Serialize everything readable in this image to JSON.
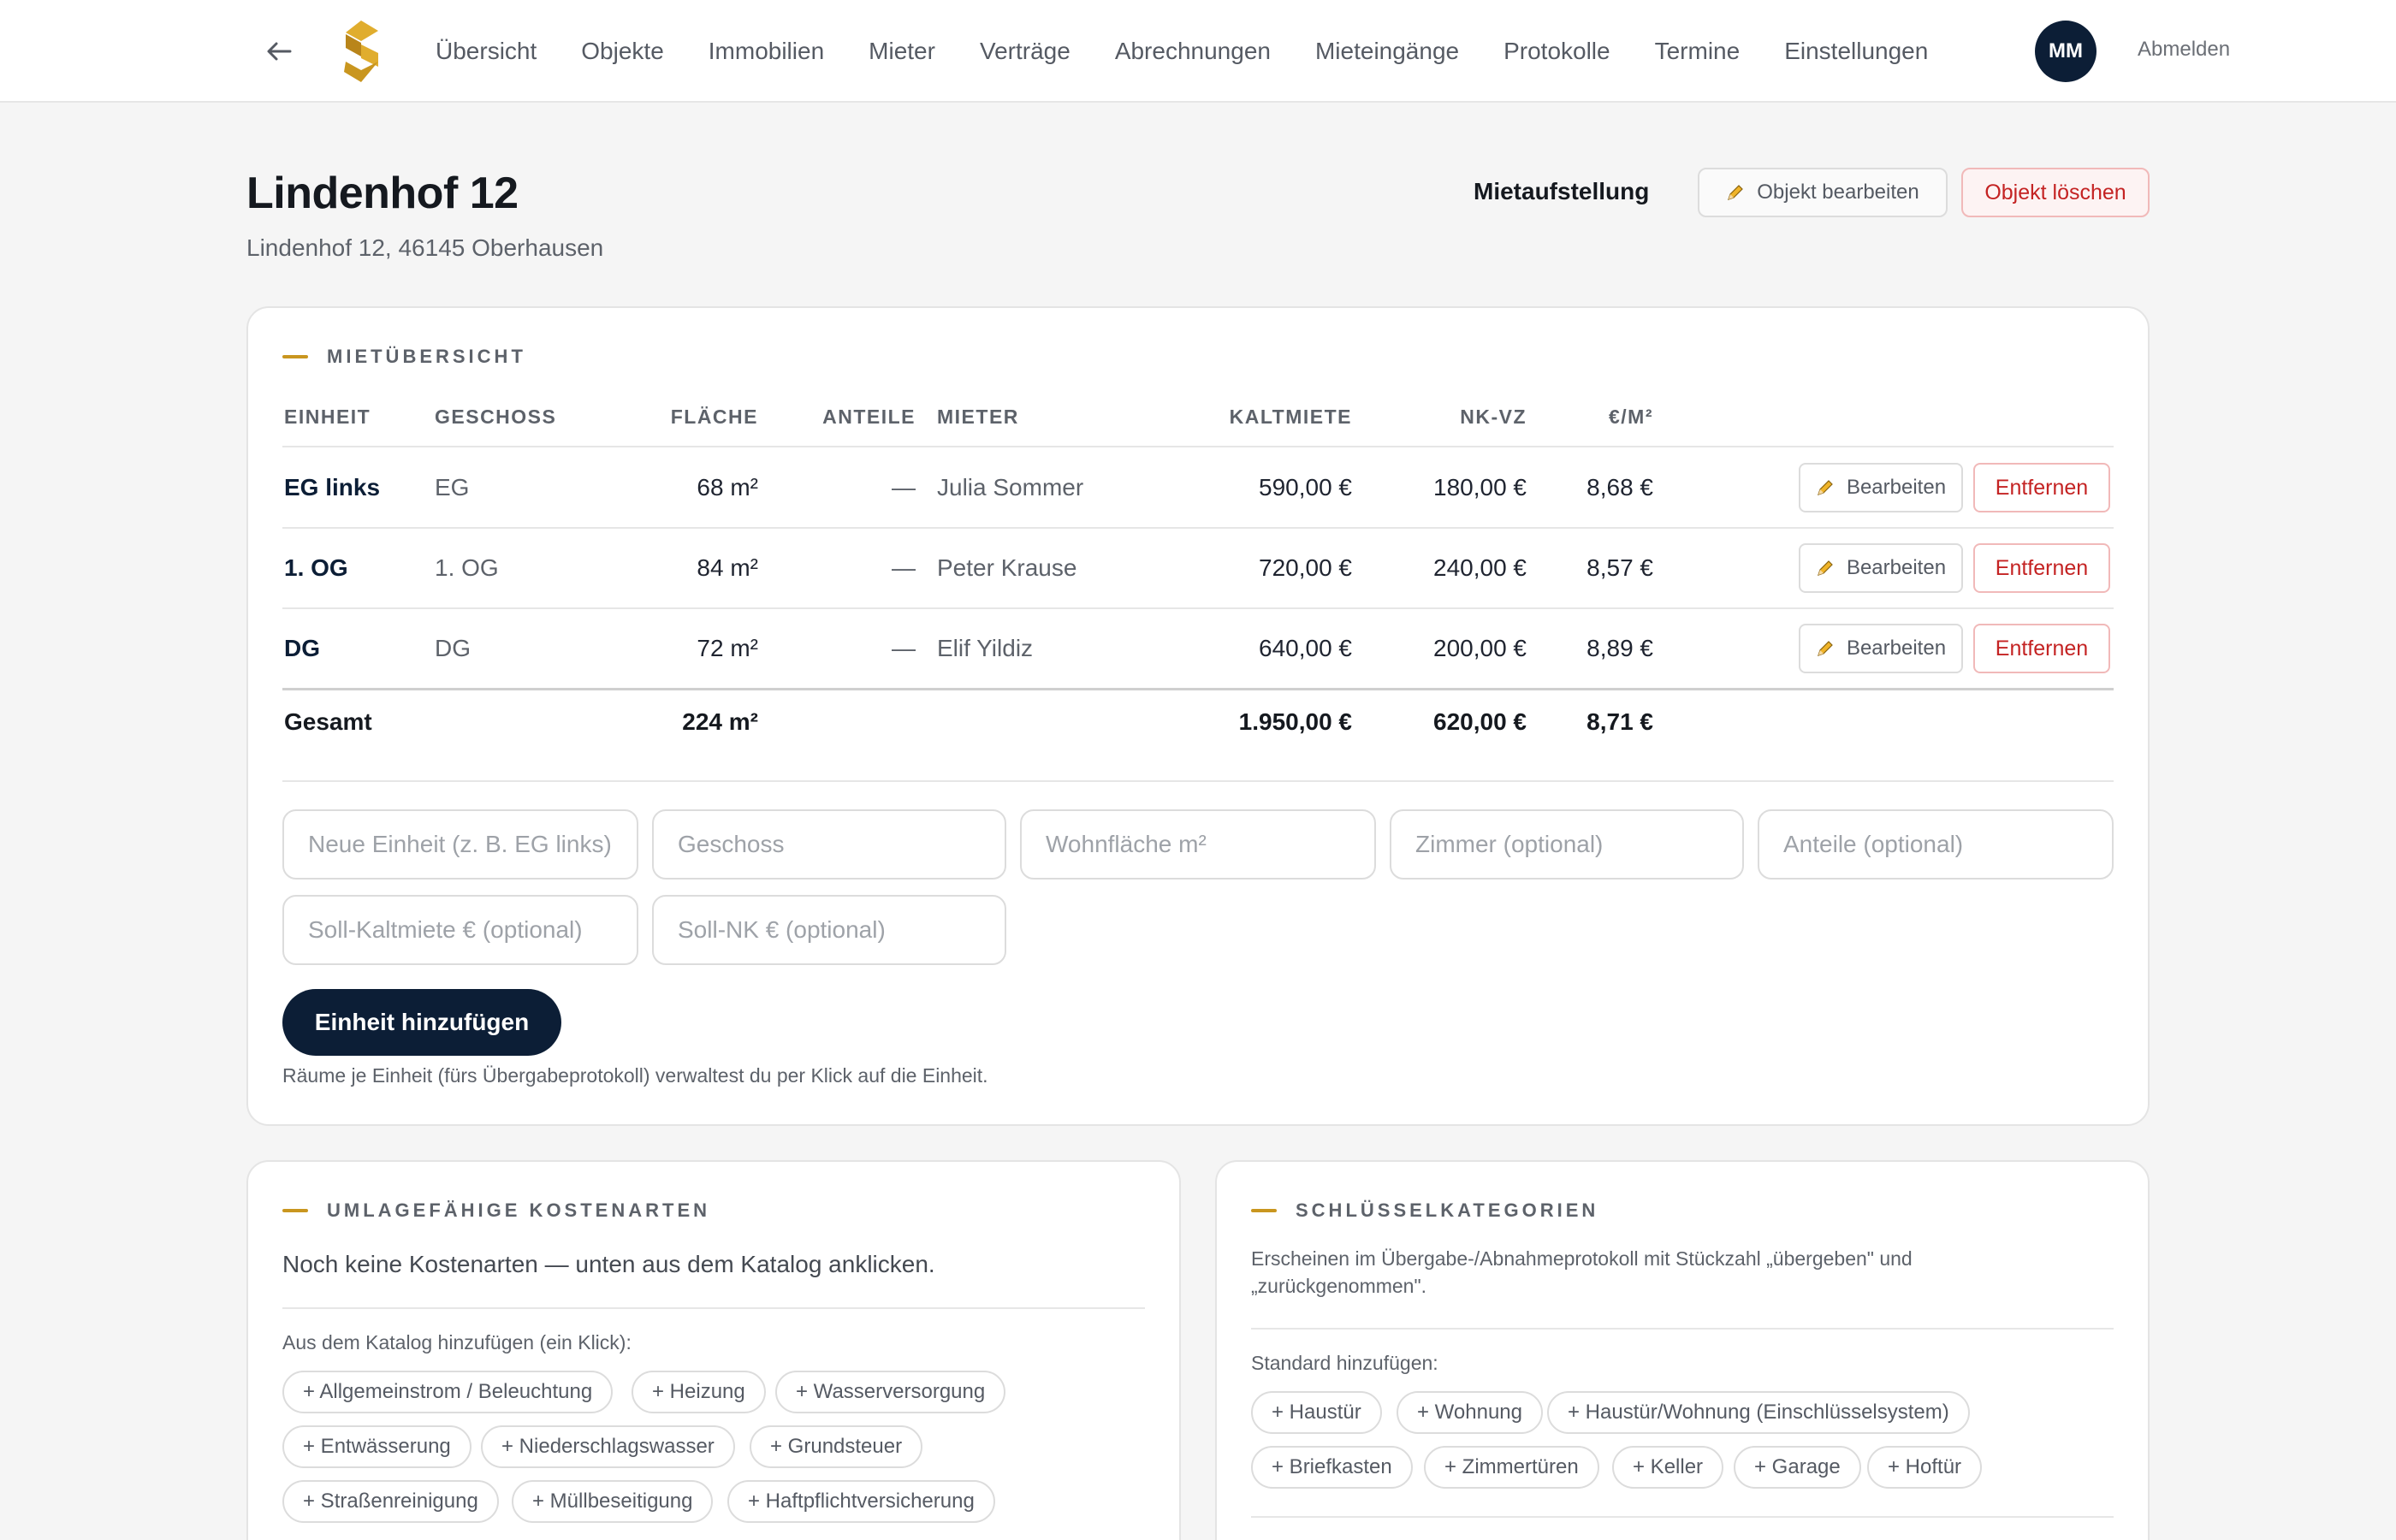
{
  "nav": {
    "links": [
      "Übersicht",
      "Objekte",
      "Immobilien",
      "Mieter",
      "Verträge",
      "Abrechnungen",
      "Mieteingänge",
      "Protokolle",
      "Termine",
      "Einstellungen"
    ],
    "avatar_initials": "MM",
    "logout_label": "Abmelden",
    "icons": {
      "back": "arrow-left-icon",
      "logo": "brand-logo"
    },
    "brand_color": "#c9961f"
  },
  "header": {
    "title": "Lindenhof 12",
    "address": "Lindenhof 12, 46145 Oberhausen",
    "rent_list_label": "Mietaufstellung",
    "edit_label": "Objekt bearbeiten",
    "delete_label": "Objekt löschen"
  },
  "rent_overview": {
    "section_title": "MIETÜBERSICHT",
    "columns": [
      "EINHEIT",
      "GESCHOSS",
      "FLÄCHE",
      "ANTEILE",
      "MIETER",
      "KALTMIETE",
      "NK-VZ",
      "€/M²"
    ],
    "rows": [
      {
        "unit": "EG links",
        "floor": "EG",
        "area": "68 m²",
        "shares": "—",
        "tenant": "Julia Sommer",
        "cold_rent": "590,00 €",
        "nk": "180,00 €",
        "per_sqm": "8,68 €"
      },
      {
        "unit": "1. OG",
        "floor": "1. OG",
        "area": "84 m²",
        "shares": "—",
        "tenant": "Peter Krause",
        "cold_rent": "720,00 €",
        "nk": "240,00 €",
        "per_sqm": "8,57 €"
      },
      {
        "unit": "DG",
        "floor": "DG",
        "area": "72 m²",
        "shares": "—",
        "tenant": "Elif Yildiz",
        "cold_rent": "640,00 €",
        "nk": "200,00 €",
        "per_sqm": "8,89 €"
      }
    ],
    "row_edit_label": "Bearbeiten",
    "row_remove_label": "Entfernen",
    "total": {
      "label": "Gesamt",
      "area": "224 m²",
      "cold_rent": "1.950,00 €",
      "nk": "620,00 €",
      "per_sqm": "8,71 €"
    },
    "form": {
      "unit_placeholder": "Neue Einheit (z. B. EG links)",
      "floor_placeholder": "Geschoss",
      "area_placeholder": "Wohnfläche m²",
      "rooms_placeholder": "Zimmer (optional)",
      "shares_placeholder": "Anteile (optional)",
      "cold_rent_placeholder": "Soll-Kaltmiete € (optional)",
      "nk_placeholder": "Soll-NK € (optional)",
      "submit_label": "Einheit hinzufügen"
    },
    "hint": "Räume je Einheit (fürs Übergabeprotokoll) verwaltest du per Klick auf die Einheit."
  },
  "cost_types": {
    "section_title": "UMLAGEFÄHIGE KOSTENARTEN",
    "empty_text": "Noch keine Kostenarten — unten aus dem Katalog anklicken.",
    "catalog_label": "Aus dem Katalog hinzufügen (ein Klick):",
    "catalog": [
      "+ Allgemeinstrom / Beleuchtung",
      "+ Heizung",
      "+ Wasserversorgung",
      "+ Entwässerung",
      "+ Niederschlagswasser",
      "+ Grundsteuer",
      "+ Straßenreinigung",
      "+ Müllbeseitigung",
      "+ Haftpflichtversicherung"
    ]
  },
  "key_categories": {
    "section_title": "SCHLÜSSELKATEGORIEN",
    "description_line1": "Erscheinen im Übergabe-/Abnahmeprotokoll mit Stückzahl „übergeben\" und",
    "description_line2": "„zurückgenommen\".",
    "standard_label": "Standard hinzufügen:",
    "standard": [
      "+ Haustür",
      "+ Wohnung",
      "+ Haustür/Wohnung (Einschlüsselsystem)",
      "+ Briefkasten",
      "+ Zimmertüren",
      "+ Keller",
      "+ Garage",
      "+ Hoftür"
    ]
  }
}
